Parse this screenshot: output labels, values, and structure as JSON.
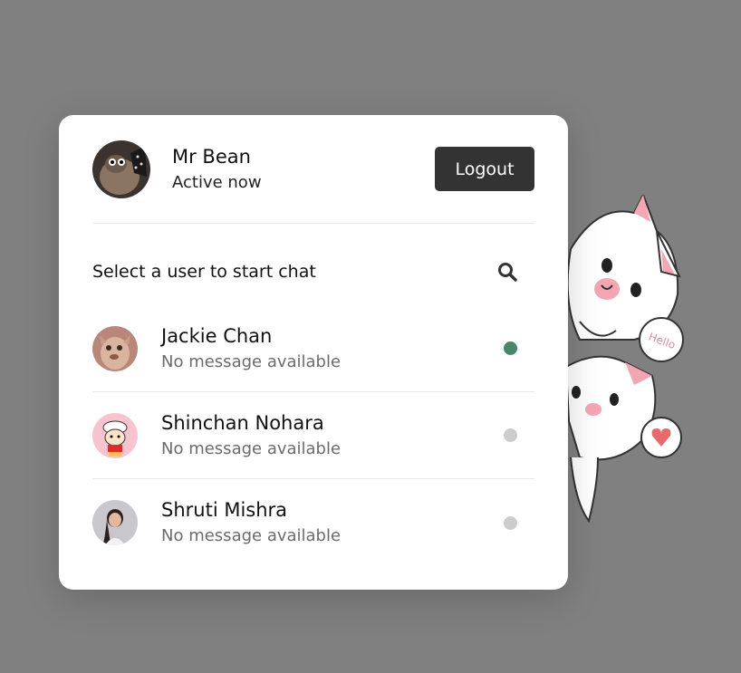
{
  "current_user": {
    "name": "Mr Bean",
    "status": "Active now"
  },
  "header": {
    "logout_label": "Logout"
  },
  "search": {
    "prompt": "Select a user to start chat",
    "icon": "search-icon"
  },
  "users": [
    {
      "name": "Jackie Chan",
      "message": "No message available",
      "online": true
    },
    {
      "name": "Shinchan Nohara",
      "message": "No message available",
      "online": false
    },
    {
      "name": "Shruti Mishra",
      "message": "No message available",
      "online": false
    }
  ],
  "decoration": {
    "sticker_text": "Hello"
  },
  "colors": {
    "online": "#468669",
    "offline": "#cccccc",
    "button_bg": "#333333",
    "page_bg": "#808080"
  }
}
